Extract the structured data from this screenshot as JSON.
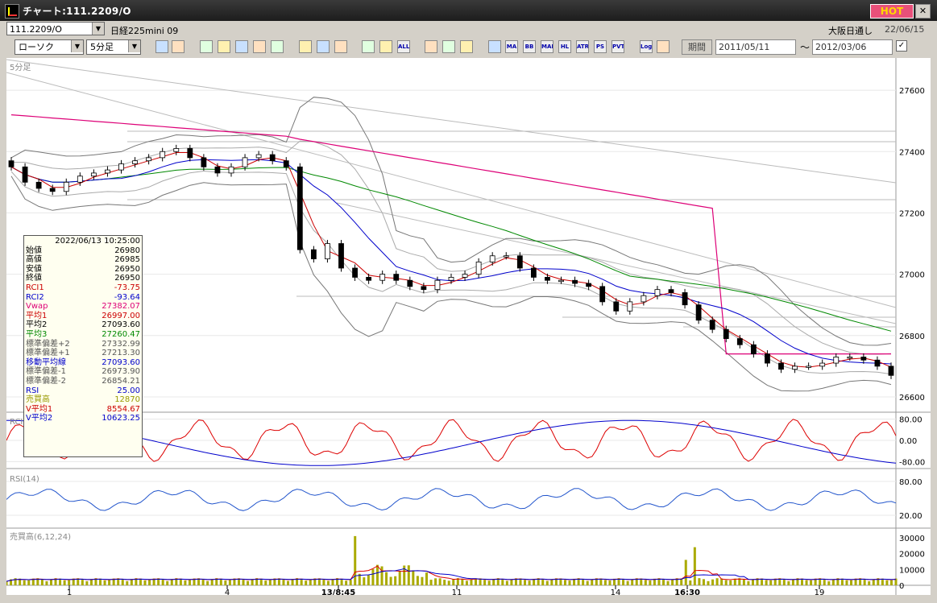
{
  "window": {
    "title": "チャート:111.2209/O",
    "hot": "HOT",
    "close": "✕"
  },
  "symbol": {
    "code": "111.2209/O",
    "name": "日経225mini 09",
    "market": "大阪日通し",
    "date": "22/06/15"
  },
  "toolbar": {
    "chart_type": "ローソク",
    "interval": "5分足",
    "period_label": "期間",
    "date_from": "2011/05/11",
    "date_to": "2012/03/06",
    "tilde": "〜",
    "icons": [
      "zoom-icon",
      "grid-icon",
      "cross-icon",
      "search-icon",
      "volume-icon",
      "swap-icon",
      "trend-icon",
      "line-draw-icon",
      "cursor-icon",
      "arrow-icon",
      "candle-icon",
      "sound-icon",
      "all-icon",
      "gear-icon",
      "wrench-icon",
      "palette-icon",
      "vol-ind-icon",
      "ma-icon",
      "bb-icon",
      "mae-icon",
      "hl-icon",
      "atr-icon",
      "ps-icon",
      "pvt-icon",
      "log-icon",
      "mark-icon"
    ],
    "icon_labels": {
      "all-icon": "ALL",
      "ma-icon": "MA",
      "bb-icon": "BB",
      "mae-icon": "MAE",
      "hl-icon": "HL",
      "atr-icon": "ATR",
      "ps-icon": "PS",
      "pvt-icon": "PVT",
      "log-icon": "Log"
    }
  },
  "panels": {
    "price_label": "5分足",
    "rci_label": "RCI",
    "rsi_label": "RSI(14)",
    "volume_label": "売買高(6,12,24)"
  },
  "price_ticks": [
    "27600",
    "27400",
    "27200",
    "27000",
    "26800",
    "26600"
  ],
  "rci_ticks": [
    "80.00",
    "0.00",
    "-80.00"
  ],
  "rsi_ticks": [
    "80.00",
    "20.00"
  ],
  "vol_ticks": [
    "30000",
    "20000",
    "10000",
    "0"
  ],
  "x_labels": [
    "1",
    "4",
    "13/8:45",
    "11",
    "14",
    "16:30",
    "19"
  ],
  "info": {
    "datetime": "2022/06/13  10:25:00",
    "rows": [
      {
        "label": "始値",
        "value": "26980",
        "color": "#000000"
      },
      {
        "label": "高値",
        "value": "26985",
        "color": "#000000"
      },
      {
        "label": "安値",
        "value": "26950",
        "color": "#000000"
      },
      {
        "label": "終値",
        "value": "26950",
        "color": "#000000"
      },
      {
        "label": "RCI1",
        "value": "-73.75",
        "color": "#cc0000"
      },
      {
        "label": "RCI2",
        "value": "-93.64",
        "color": "#0000cc"
      },
      {
        "label": "Vwap",
        "value": "27382.07",
        "color": "#dd0077"
      },
      {
        "label": "平均1",
        "value": "26997.00",
        "color": "#cc0000"
      },
      {
        "label": "平均2",
        "value": "27093.60",
        "color": "#000000"
      },
      {
        "label": "平均3",
        "value": "27260.47",
        "color": "#008800"
      },
      {
        "label": "標準偏差+2",
        "value": "27332.99",
        "color": "#555555"
      },
      {
        "label": "標準偏差+1",
        "value": "27213.30",
        "color": "#555555"
      },
      {
        "label": "移動平均線",
        "value": "27093.60",
        "color": "#0000cc"
      },
      {
        "label": "標準偏差-1",
        "value": "26973.90",
        "color": "#555555"
      },
      {
        "label": "標準偏差-2",
        "value": "26854.21",
        "color": "#555555"
      },
      {
        "label": "RSI",
        "value": "25.00",
        "color": "#0000cc"
      },
      {
        "label": "売買高",
        "value": "12870",
        "color": "#999900"
      },
      {
        "label": "V平均1",
        "value": "8554.67",
        "color": "#cc0000"
      },
      {
        "label": "V平均2",
        "value": "10623.25",
        "color": "#0000cc"
      }
    ]
  },
  "chart_data": {
    "type": "line",
    "y_range": [
      26550,
      27700
    ],
    "close": [
      27350,
      27300,
      27280,
      27270,
      27300,
      27320,
      27330,
      27340,
      27360,
      27370,
      27380,
      27400,
      27410,
      27380,
      27350,
      27330,
      27350,
      27380,
      27390,
      27370,
      27350,
      27080,
      27050,
      27100,
      27020,
      26990,
      26980,
      27000,
      26980,
      26960,
      26950,
      26980,
      26990,
      27000,
      27040,
      27060,
      27060,
      27020,
      26990,
      26980,
      26980,
      26970,
      26960,
      26910,
      26880,
      26910,
      26930,
      26950,
      26940,
      26900,
      26850,
      26820,
      26790,
      26770,
      26740,
      26710,
      26690,
      26700,
      26700,
      26710,
      26730,
      26730,
      26720,
      26700,
      26670
    ],
    "colors": {
      "up": "#ffffff",
      "down": "#000000",
      "ma1": "#cc0000",
      "ma2": "#0000cc",
      "ma3": "#008800",
      "vwap": "#dd0077",
      "band": "#777777"
    }
  }
}
